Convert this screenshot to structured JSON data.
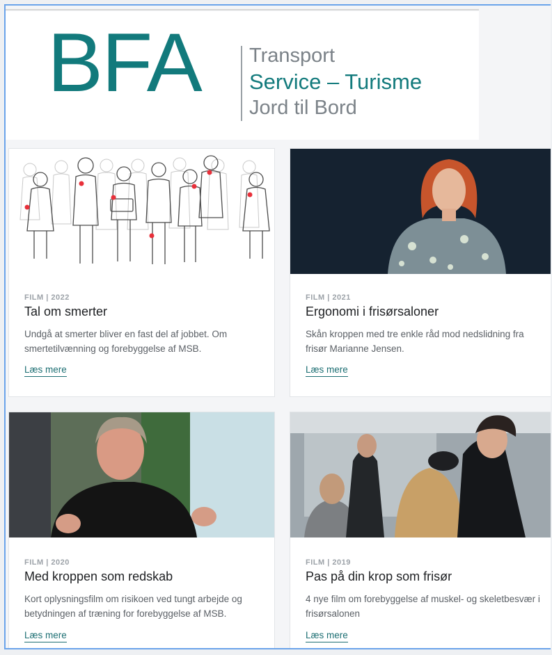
{
  "logo": {
    "acronym": "BFA",
    "line1": "Transport",
    "line2": "Service – Turisme",
    "line3": "Jord til Bord"
  },
  "cards": [
    {
      "meta": "FILM | 2022",
      "title": "Tal om smerter",
      "description": "Undgå at smerter bliver en fast del af jobbet. Om smertetilvænning og forebyggelse af MSB.",
      "link": "Læs mere"
    },
    {
      "meta": "FILM | 2021",
      "title": "Ergonomi i frisørsaloner",
      "description": "Skån kroppen med tre enkle råd mod nedslidning fra frisør Marianne Jensen.",
      "link": "Læs mere"
    },
    {
      "meta": "FILM | 2020",
      "title": "Med kroppen som redskab",
      "description": "Kort oplysningsfilm om risikoen ved tungt arbejde og betydningen af træning for forebyggelse af MSB.",
      "link": "Læs mere"
    },
    {
      "meta": "FILM | 2019",
      "title": "Pas på din krop som frisør",
      "description": "4 nye film om forebyggelse af muskel- og skeletbesvær i frisørsalonen",
      "link": "Læs mere"
    }
  ],
  "colors": {
    "brand_teal": "#127a7c",
    "link": "#1d6f73",
    "logo_grey": "#7b8288"
  }
}
